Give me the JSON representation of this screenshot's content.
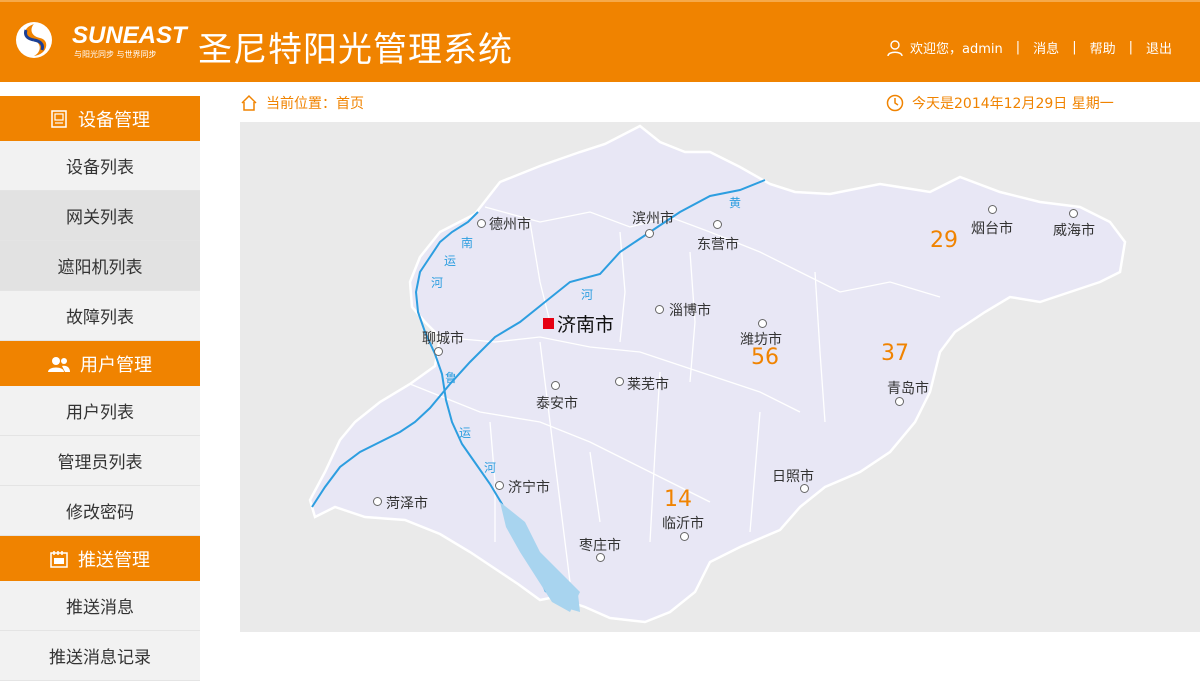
{
  "header": {
    "logo_text": "SUNEAST",
    "logo_slogan": "与阳光同步 与世界同步",
    "app_title": "圣尼特阳光管理系统",
    "greeting": "欢迎您，admin",
    "nav": [
      "消息",
      "帮助",
      "退出"
    ]
  },
  "sidebar": {
    "groups": [
      {
        "title": "设备管理",
        "icon": "device-icon",
        "items": [
          "设备列表",
          "网关列表",
          "遮阳机列表",
          "故障列表"
        ]
      },
      {
        "title": "用户管理",
        "icon": "users-icon",
        "items": [
          "用户列表",
          "管理员列表",
          "修改密码"
        ]
      },
      {
        "title": "推送管理",
        "icon": "push-icon",
        "items": [
          "推送消息",
          "推送消息记录"
        ]
      }
    ]
  },
  "breadcrumb": "当前位置：首页",
  "date_text": "今天是2014年12月29日 星期一",
  "map": {
    "capital": "济南市",
    "cities": [
      "德州市",
      "滨州市",
      "东营市",
      "烟台市",
      "威海市",
      "淄博市",
      "潍坊市",
      "聊城市",
      "泰安市",
      "莱芜市",
      "青岛市",
      "济宁市",
      "菏泽市",
      "日照市",
      "临沂市",
      "枣庄市"
    ],
    "counts": [
      "29",
      "56",
      "37",
      "14"
    ],
    "river_chars": [
      "南",
      "运",
      "河",
      "黄",
      "河",
      "鲁",
      "运",
      "河"
    ],
    "colors": {
      "province_fill": "#e8e7f5",
      "river": "#2d9ee0",
      "count": "#f08300",
      "capital_marker": "#e60012"
    }
  }
}
